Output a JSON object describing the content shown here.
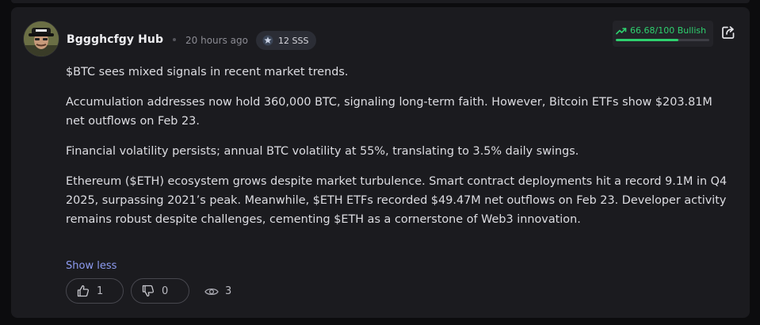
{
  "post": {
    "author": "Bggghcfgy Hub",
    "time": "20 hours ago",
    "badge": {
      "icon": "star-badge-icon",
      "label": "12 SSS"
    },
    "sentiment": {
      "label": "66.68/100 Bullish",
      "score": 66.68,
      "max": 100,
      "color": "#2ed06e",
      "icon": "trending-up-icon"
    },
    "paragraphs": [
      "$BTC sees mixed signals in recent market trends.",
      "Accumulation addresses now hold 360,000 BTC, signaling long-term faith. However, Bitcoin ETFs show $203.81M net outflows on Feb 23.",
      "Financial volatility persists; annual BTC volatility at 55%, translating to 3.5% daily swings.",
      "Ethereum ($ETH) ecosystem grows despite market turbulence. Smart contract deployments hit a record 9.1M in Q4 2025, surpassing 2021’s peak. Meanwhile, $ETH ETFs recorded $49.47M net outflows on Feb 23. Developer activity remains robust despite challenges, cementing $ETH as a cornerstone of Web3 innovation."
    ],
    "show_less": "Show less",
    "likes": "1",
    "dislikes": "0",
    "views": "3"
  }
}
